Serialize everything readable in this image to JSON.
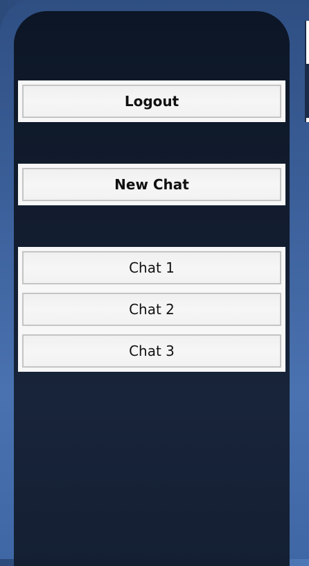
{
  "sidebar": {
    "logout_label": "Logout",
    "new_chat_label": "New Chat",
    "chats": [
      {
        "label": "Chat 1"
      },
      {
        "label": "Chat 2"
      },
      {
        "label": "Chat 3"
      }
    ]
  },
  "colors": {
    "sidebar_bg": "#0c1626",
    "frame_bg": "#3b5f99",
    "button_bg": "#f3f3f3",
    "button_border": "#c4c4c4",
    "text": "#111111"
  }
}
